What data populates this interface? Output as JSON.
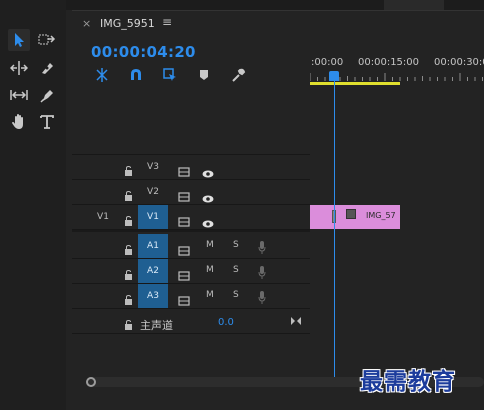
{
  "sequence": {
    "tab_close": "×",
    "title": "IMG_5951",
    "menu_icon": "≡",
    "timecode": "00:00:04:20"
  },
  "ruler": {
    "labels": [
      ":00:00",
      "00:00:15:00",
      "00:00:30:0"
    ]
  },
  "video_tracks": [
    {
      "name": "V3",
      "source_target": ""
    },
    {
      "name": "V2",
      "source_target": ""
    },
    {
      "name": "V1",
      "source_target": "V1"
    }
  ],
  "audio_tracks": [
    {
      "name": "A1",
      "mute": "M",
      "solo": "S"
    },
    {
      "name": "A2",
      "mute": "M",
      "solo": "S"
    },
    {
      "name": "A3",
      "mute": "M",
      "solo": "S"
    }
  ],
  "clip": {
    "label": "IMG_57",
    "color": "#db8ddb"
  },
  "master": {
    "label": "主声道",
    "value": "0.0"
  },
  "watermark": "最需教育",
  "colors": {
    "accent": "#2d8ceb",
    "work_area": "#e0df2f",
    "track_active": "#1f5f92"
  },
  "icons": {
    "tools": [
      "selection-tool-icon",
      "track-select-forward-icon",
      "ripple-edit-icon",
      "razor-icon",
      "slip-icon",
      "pen-icon",
      "hand-icon",
      "type-icon"
    ],
    "controls": [
      "snap-nest-icon",
      "snap-magnet-icon",
      "linked-selection-icon",
      "add-marker-icon",
      "timeline-settings-icon"
    ]
  }
}
